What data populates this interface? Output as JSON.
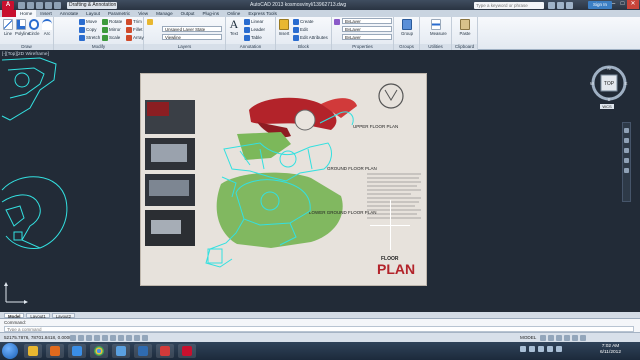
{
  "app": {
    "logo": "A",
    "workspace": "Drafting & Annotation",
    "title": "AutoCAD 2013   kosmosvinyl/13962713.dwg",
    "search_placeholder": "Type a keyword or phrase",
    "sign_in": "Sign In"
  },
  "ribbon_tabs": [
    "Home",
    "Insert",
    "Annotate",
    "Layout",
    "Parametric",
    "View",
    "Manage",
    "Output",
    "Plug-ins",
    "Online",
    "Express Tools"
  ],
  "ribbon_active_tab": "Home",
  "ribbon": {
    "draw": {
      "title": "Draw",
      "line": "Line",
      "polyline": "Polyline",
      "circle": "Circle",
      "arc": "Arc"
    },
    "modify": {
      "title": "Modify",
      "move": "Move",
      "rotate": "Rotate",
      "trim": "Trim",
      "copy": "Copy",
      "mirror": "Mirror",
      "fillet": "Fillet",
      "stretch": "Stretch",
      "scale": "Scale",
      "array": "Array"
    },
    "layers": {
      "title": "Layers",
      "layer_state": "Unsaved Layer State",
      "current_layer": "Viewline"
    },
    "annotation": {
      "title": "Annotation",
      "text": "Text",
      "linear": "Linear",
      "leader": "Leader",
      "table": "Table"
    },
    "block": {
      "title": "Block",
      "insert": "Insert",
      "create": "Create",
      "edit": "Edit",
      "edit_attributes": "Edit Attributes"
    },
    "properties": {
      "title": "Properties",
      "color": "ByLayer",
      "linetype": "ByLayer",
      "lineweight": "ByLayer"
    },
    "groups": {
      "title": "Groups",
      "group": "Group"
    },
    "utilities": {
      "title": "Utilities",
      "measure": "Measure"
    },
    "clipboard": {
      "title": "Clipboard",
      "paste": "Paste"
    }
  },
  "viewport_label": "[-][Top][2D Wireframe]",
  "viewcube": {
    "top": "TOP",
    "n": "N",
    "s": "S",
    "e": "E",
    "w": "W",
    "wcs": "WCS"
  },
  "sheet": {
    "upper_plan": "UPPER FLOOR PLAN",
    "ground_plan": "GROUND FLOOR PLAN",
    "lower_ground_plan": "LOWER GROUND FLOOR PLAN",
    "title_small": "FLOOR",
    "title_big": "PLAN"
  },
  "layout_tabs": [
    "Model",
    "Layout1",
    "Layout2"
  ],
  "layout_active": "Model",
  "command": {
    "history": "Command:",
    "placeholder": "Type a command"
  },
  "status": {
    "coords": "52175.7876, 78701.8418, 0.0000",
    "model": "MODEL"
  },
  "clock": {
    "time": "7:02 AM",
    "date": "6/11/2012"
  },
  "colors": {
    "accent": "#c8102e",
    "drawing_bg": "#222b37",
    "cyan_outline": "#33e0e0"
  }
}
